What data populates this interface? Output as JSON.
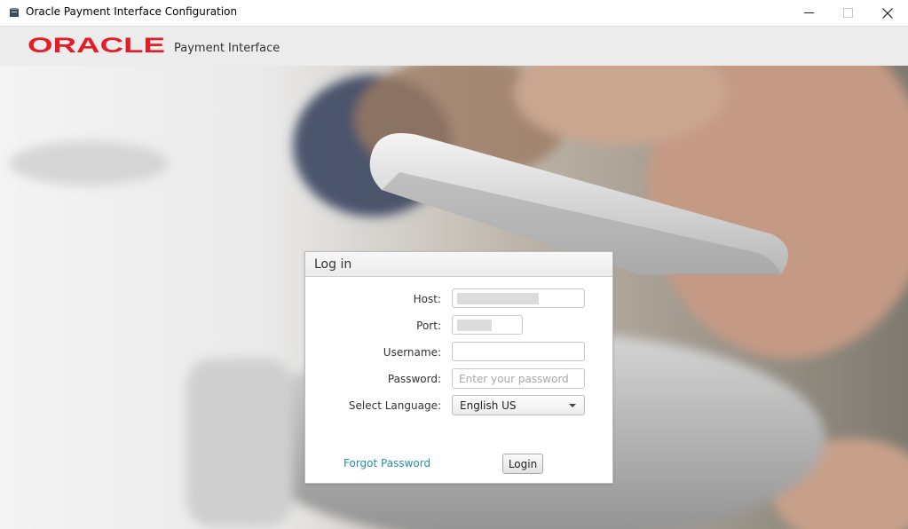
{
  "window": {
    "title": "Oracle Payment Interface Configuration",
    "controls": [
      "minimize-icon",
      "maximize-icon",
      "close-icon"
    ]
  },
  "header": {
    "logo_text": "ORACLE",
    "product_name": "Payment Interface",
    "brand_color": "#e31e26"
  },
  "login": {
    "title": "Log in",
    "host_label": "Host:",
    "host_value": "",
    "port_label": "Port:",
    "port_value": "",
    "username_label": "Username:",
    "username_value": "",
    "password_label": "Password:",
    "password_placeholder": "Enter your password",
    "language_label": "Select Language:",
    "language_value": "English US",
    "forgot_link": "Forgot Password",
    "login_button": "Login",
    "link_color": "#2a8cad"
  }
}
